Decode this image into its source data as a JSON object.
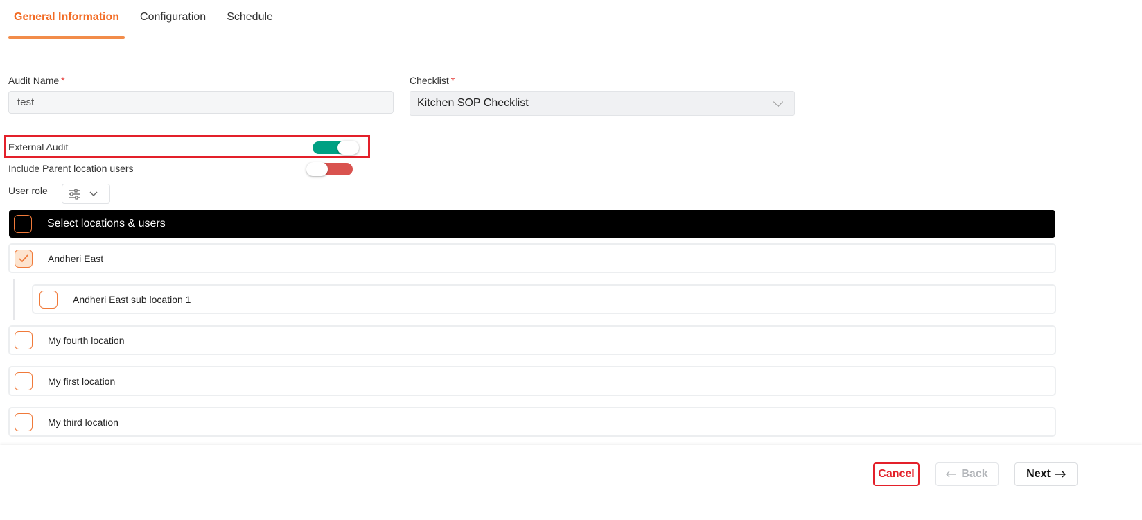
{
  "tabs": [
    {
      "label": "General Information",
      "active": true
    },
    {
      "label": "Configuration",
      "active": false
    },
    {
      "label": "Schedule",
      "active": false
    }
  ],
  "audit_name": {
    "label": "Audit Name",
    "required_mark": "*",
    "value": "test"
  },
  "checklist": {
    "label": "Checklist",
    "required_mark": "*",
    "value": "Kitchen SOP Checklist"
  },
  "external_audit": {
    "label": "External Audit",
    "enabled": true
  },
  "include_parent": {
    "label": "Include Parent location users",
    "enabled": false
  },
  "user_role": {
    "label": "User role"
  },
  "locations": {
    "header": "Select locations & users",
    "items": [
      {
        "name": "Andheri East",
        "checked": true
      },
      {
        "name": "Andheri East sub location 1",
        "checked": false
      },
      {
        "name": "My fourth location",
        "checked": false
      },
      {
        "name": "My first location",
        "checked": false
      },
      {
        "name": "My third location",
        "checked": false
      }
    ]
  },
  "footer": {
    "cancel": "Cancel",
    "back": "Back",
    "next": "Next"
  },
  "colors": {
    "accent": "#f26b24",
    "toggle_on": "#00a083",
    "toggle_off": "#d9534f",
    "danger": "#e3202a"
  }
}
